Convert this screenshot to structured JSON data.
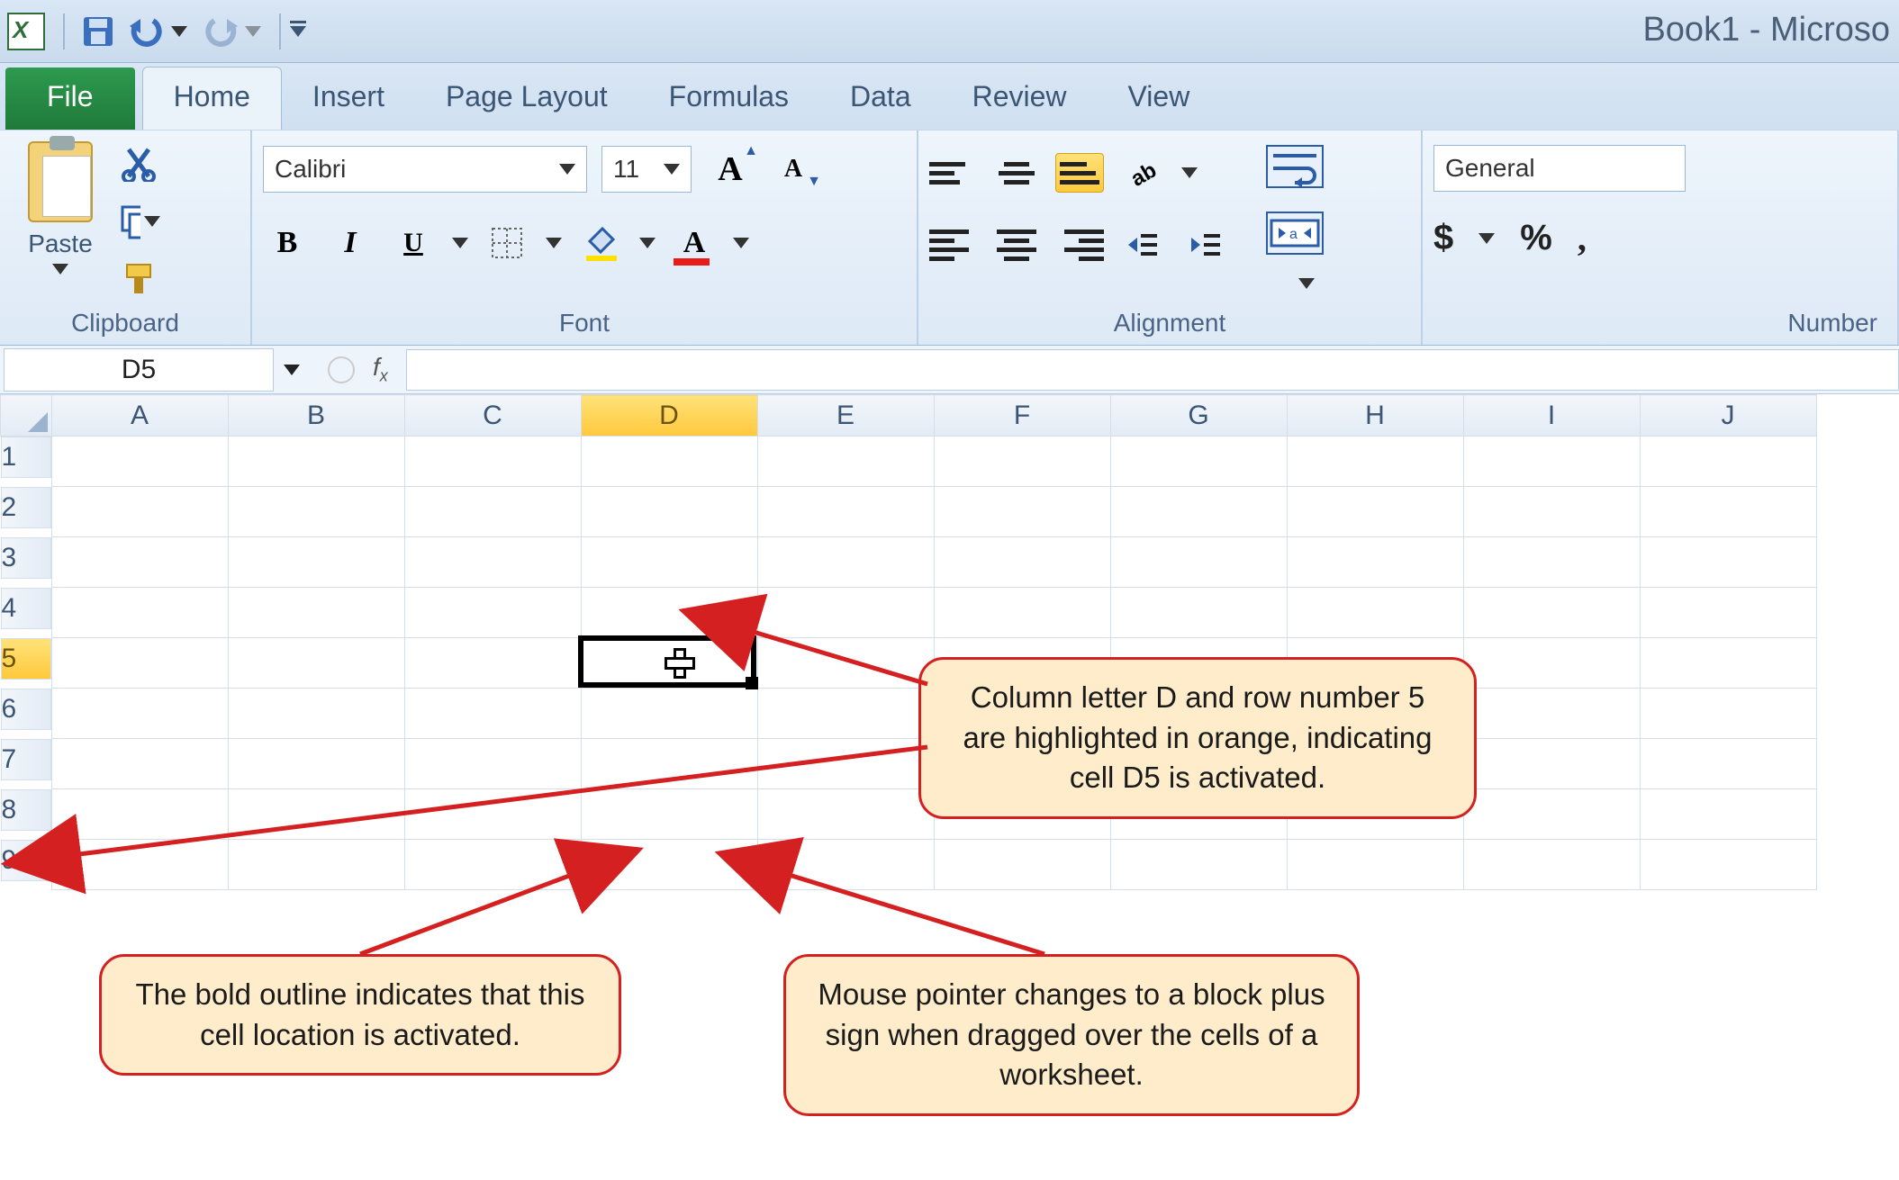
{
  "title": "Book1 - Microso",
  "qat": {
    "save": "Save",
    "undo": "Undo",
    "redo": "Redo",
    "customize": "Customize"
  },
  "tabs": {
    "file": "File",
    "home": "Home",
    "insert": "Insert",
    "page_layout": "Page Layout",
    "formulas": "Formulas",
    "data": "Data",
    "review": "Review",
    "view": "View"
  },
  "ribbon": {
    "clipboard": {
      "label": "Clipboard",
      "paste": "Paste"
    },
    "font": {
      "label": "Font",
      "name": "Calibri",
      "size": "11",
      "bold": "B",
      "italic": "I",
      "underline": "U",
      "grow": "A",
      "shrink": "A"
    },
    "alignment": {
      "label": "Alignment"
    },
    "number": {
      "label": "Number",
      "format": "General",
      "currency": "$",
      "percent": "%",
      "comma": ","
    }
  },
  "namebox": "D5",
  "columns": [
    "A",
    "B",
    "C",
    "D",
    "E",
    "F",
    "G",
    "H",
    "I",
    "J"
  ],
  "rows": [
    "1",
    "2",
    "3",
    "4",
    "5",
    "6",
    "7",
    "8",
    "9"
  ],
  "active": {
    "col": "D",
    "row": "5"
  },
  "callouts": {
    "c1": "Column letter D and row number 5 are highlighted in orange, indicating cell D5 is activated.",
    "c2": "The bold outline indicates that this cell location is activated.",
    "c3": "Mouse pointer changes to a block plus sign when dragged over the cells of a worksheet."
  }
}
